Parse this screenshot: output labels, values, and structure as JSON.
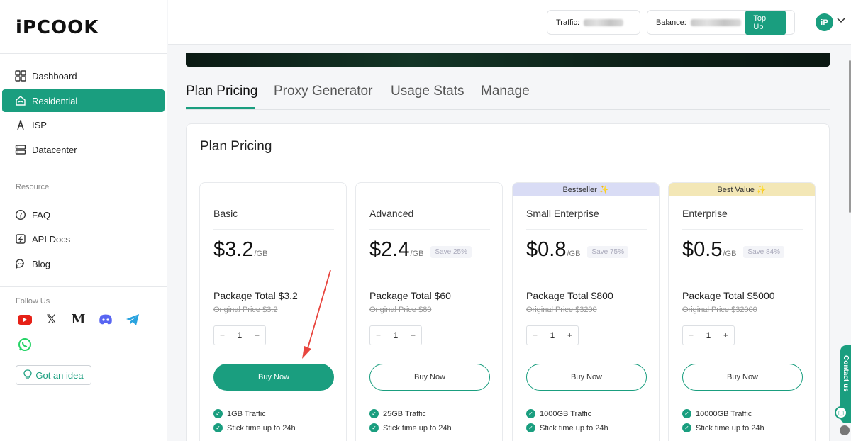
{
  "brand": {
    "logo": "iPCOOK",
    "accent": "#1a9e7f"
  },
  "sidebar": {
    "nav": [
      {
        "label": "Dashboard",
        "icon": "dashboard-icon",
        "active": false
      },
      {
        "label": "Residential",
        "icon": "home-icon",
        "active": true
      },
      {
        "label": "ISP",
        "icon": "tower-icon",
        "active": false
      },
      {
        "label": "Datacenter",
        "icon": "server-icon",
        "active": false
      }
    ],
    "resource_label": "Resource",
    "resources": [
      {
        "label": "FAQ",
        "icon": "question-icon"
      },
      {
        "label": "API Docs",
        "icon": "api-icon"
      },
      {
        "label": "Blog",
        "icon": "chat-icon"
      }
    ],
    "follow_label": "Follow Us",
    "social": [
      "youtube-icon",
      "x-icon",
      "medium-icon",
      "discord-icon",
      "telegram-icon",
      "whatsapp-icon"
    ],
    "idea_label": "Got an idea"
  },
  "header": {
    "traffic_label": "Traffic:",
    "balance_label": "Balance:",
    "topup_label": "Top Up",
    "avatar_text": "iP"
  },
  "tabs": [
    "Plan Pricing",
    "Proxy Generator",
    "Usage Stats",
    "Manage"
  ],
  "panel_title": "Plan Pricing",
  "plans": [
    {
      "ribbon": "",
      "name": "Basic",
      "price": "$3.2",
      "per": "/GB",
      "save": "",
      "package": "Package Total $3.2",
      "original": "Original Price $3.2",
      "qty": "1",
      "buy": "Buy Now",
      "primary": true,
      "features": [
        "1GB Traffic",
        "Stick time up to 24h"
      ]
    },
    {
      "ribbon": "",
      "name": "Advanced",
      "price": "$2.4",
      "per": "/GB",
      "save": "Save 25%",
      "package": "Package Total $60",
      "original": "Original Price $80",
      "qty": "1",
      "buy": "Buy Now",
      "primary": false,
      "features": [
        "25GB Traffic",
        "Stick time up to 24h"
      ]
    },
    {
      "ribbon": "Bestseller ✨",
      "ribbon_color": "#d9dcf5",
      "name": "Small Enterprise",
      "price": "$0.8",
      "per": "/GB",
      "save": "Save 75%",
      "package": "Package Total $800",
      "original": "Original Price $3200",
      "qty": "1",
      "buy": "Buy Now",
      "primary": false,
      "features": [
        "1000GB Traffic",
        "Stick time up to 24h"
      ]
    },
    {
      "ribbon": "Best Value ✨",
      "ribbon_color": "#f3e7b6",
      "name": "Enterprise",
      "price": "$0.5",
      "per": "/GB",
      "save": "Save 84%",
      "package": "Package Total $5000",
      "original": "Original Price $32000",
      "qty": "1",
      "buy": "Buy Now",
      "primary": false,
      "features": [
        "10000GB Traffic",
        "Stick time up to 24h"
      ]
    }
  ],
  "contact_label": "Contact us"
}
